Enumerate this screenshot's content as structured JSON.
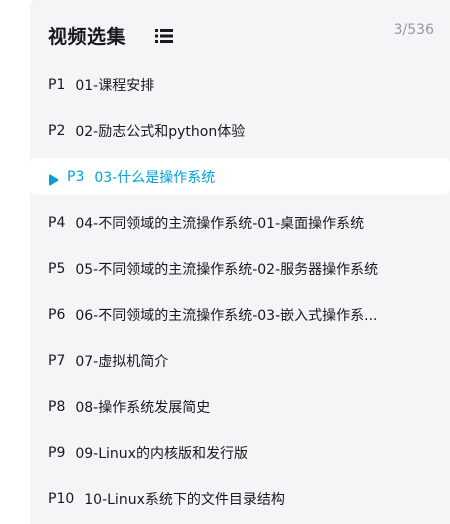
{
  "panel": {
    "title": "视频选集",
    "counter": "3/536",
    "accent_color": "#00a1d6"
  },
  "episodes": [
    {
      "num": "P1",
      "title": "01-课程安排",
      "active": false
    },
    {
      "num": "P2",
      "title": "02-励志公式和python体验",
      "active": false
    },
    {
      "num": "P3",
      "title": "03-什么是操作系统",
      "active": true
    },
    {
      "num": "P4",
      "title": "04-不同领域的主流操作系统-01-桌面操作系统",
      "active": false
    },
    {
      "num": "P5",
      "title": "05-不同领域的主流操作系统-02-服务器操作系统",
      "active": false
    },
    {
      "num": "P6",
      "title": "06-不同领域的主流操作系统-03-嵌入式操作系...",
      "active": false
    },
    {
      "num": "P7",
      "title": "07-虚拟机简介",
      "active": false
    },
    {
      "num": "P8",
      "title": "08-操作系统发展简史",
      "active": false
    },
    {
      "num": "P9",
      "title": "09-Linux的内核版和发行版",
      "active": false
    },
    {
      "num": "P10",
      "title": "10-Linux系统下的文件目录结构",
      "active": false
    }
  ]
}
